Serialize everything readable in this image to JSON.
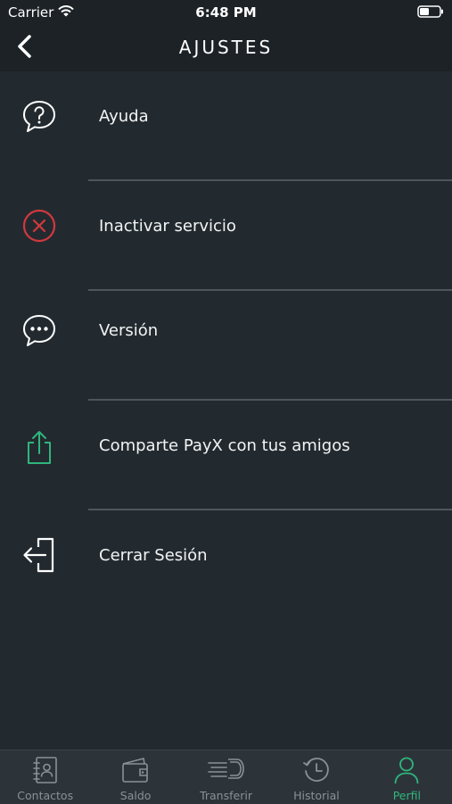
{
  "status_bar": {
    "carrier": "Carrier",
    "time": "6:48 PM"
  },
  "nav": {
    "title": "AJUSTES",
    "back_icon": "chevron-left-icon"
  },
  "menu": {
    "items": [
      {
        "label": "Ayuda",
        "icon": "help-bubble-icon",
        "icon_color": "#ffffff"
      },
      {
        "label": "Inactivar servicio",
        "icon": "cancel-circle-icon",
        "icon_color": "#d0393e"
      },
      {
        "label": "Versión",
        "icon": "chat-bubble-icon",
        "icon_color": "#ffffff"
      },
      {
        "label": "Comparte PayX con tus amigos",
        "icon": "share-icon",
        "icon_color": "#2eb67d"
      },
      {
        "label": "Cerrar Sesión",
        "icon": "logout-icon",
        "icon_color": "#ffffff"
      }
    ]
  },
  "tabs": [
    {
      "label": "Contactos",
      "icon": "contacts-book-icon"
    },
    {
      "label": "Saldo",
      "icon": "wallet-icon"
    },
    {
      "label": "Transferir",
      "icon": "transfer-icon"
    },
    {
      "label": "Historial",
      "icon": "history-clock-icon"
    },
    {
      "label": "Perfil",
      "icon": "profile-person-icon",
      "active": true
    }
  ],
  "colors": {
    "background": "#232a2f",
    "header": "#1c2226",
    "tab_bar": "#2d3439",
    "accent": "#2eb67d",
    "danger": "#d0393e",
    "inactive_tab": "#8a9196"
  }
}
